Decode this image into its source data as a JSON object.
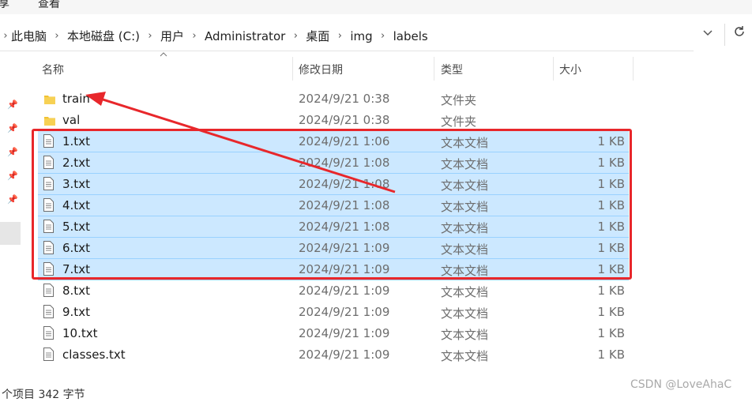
{
  "menubar": {
    "items": [
      "享",
      "查看"
    ]
  },
  "address": {
    "crumbs": [
      "此电脑",
      "本地磁盘 (C:)",
      "用户",
      "Administrator",
      "桌面",
      "img",
      "labels"
    ]
  },
  "columns": {
    "name": "名称",
    "date": "修改日期",
    "type": "类型",
    "size": "大小"
  },
  "files": [
    {
      "name": "train",
      "date": "2024/9/21 0:38",
      "type": "文件夹",
      "size": "",
      "kind": "folder",
      "selected": false
    },
    {
      "name": "val",
      "date": "2024/9/21 0:38",
      "type": "文件夹",
      "size": "",
      "kind": "folder",
      "selected": false
    },
    {
      "name": "1.txt",
      "date": "2024/9/21 1:06",
      "type": "文本文档",
      "size": "1 KB",
      "kind": "file",
      "selected": true
    },
    {
      "name": "2.txt",
      "date": "2024/9/21 1:08",
      "type": "文本文档",
      "size": "1 KB",
      "kind": "file",
      "selected": true
    },
    {
      "name": "3.txt",
      "date": "2024/9/21 1:08",
      "type": "文本文档",
      "size": "1 KB",
      "kind": "file",
      "selected": true
    },
    {
      "name": "4.txt",
      "date": "2024/9/21 1:08",
      "type": "文本文档",
      "size": "1 KB",
      "kind": "file",
      "selected": true
    },
    {
      "name": "5.txt",
      "date": "2024/9/21 1:08",
      "type": "文本文档",
      "size": "1 KB",
      "kind": "file",
      "selected": true
    },
    {
      "name": "6.txt",
      "date": "2024/9/21 1:09",
      "type": "文本文档",
      "size": "1 KB",
      "kind": "file",
      "selected": true
    },
    {
      "name": "7.txt",
      "date": "2024/9/21 1:09",
      "type": "文本文档",
      "size": "1 KB",
      "kind": "file",
      "selected": true
    },
    {
      "name": "8.txt",
      "date": "2024/9/21 1:09",
      "type": "文本文档",
      "size": "1 KB",
      "kind": "file",
      "selected": false
    },
    {
      "name": "9.txt",
      "date": "2024/9/21 1:09",
      "type": "文本文档",
      "size": "1 KB",
      "kind": "file",
      "selected": false
    },
    {
      "name": "10.txt",
      "date": "2024/9/21 1:09",
      "type": "文本文档",
      "size": "1 KB",
      "kind": "file",
      "selected": false
    },
    {
      "name": "classes.txt",
      "date": "2024/9/21 1:09",
      "type": "文本文档",
      "size": "1 KB",
      "kind": "file",
      "selected": false
    }
  ],
  "status": {
    "text": "个项目  342 字节"
  },
  "watermark": "CSDN @LoveAhaC",
  "colors": {
    "selection": "#cce8ff",
    "annotation": "#e8272b",
    "folder": "#f1c232"
  },
  "icons": {
    "pin": "pin-icon",
    "folder": "folder-icon",
    "file": "text-file-icon",
    "refresh": "refresh-icon",
    "chevron": "chevron-down-icon",
    "sort": "sort-up-icon"
  }
}
